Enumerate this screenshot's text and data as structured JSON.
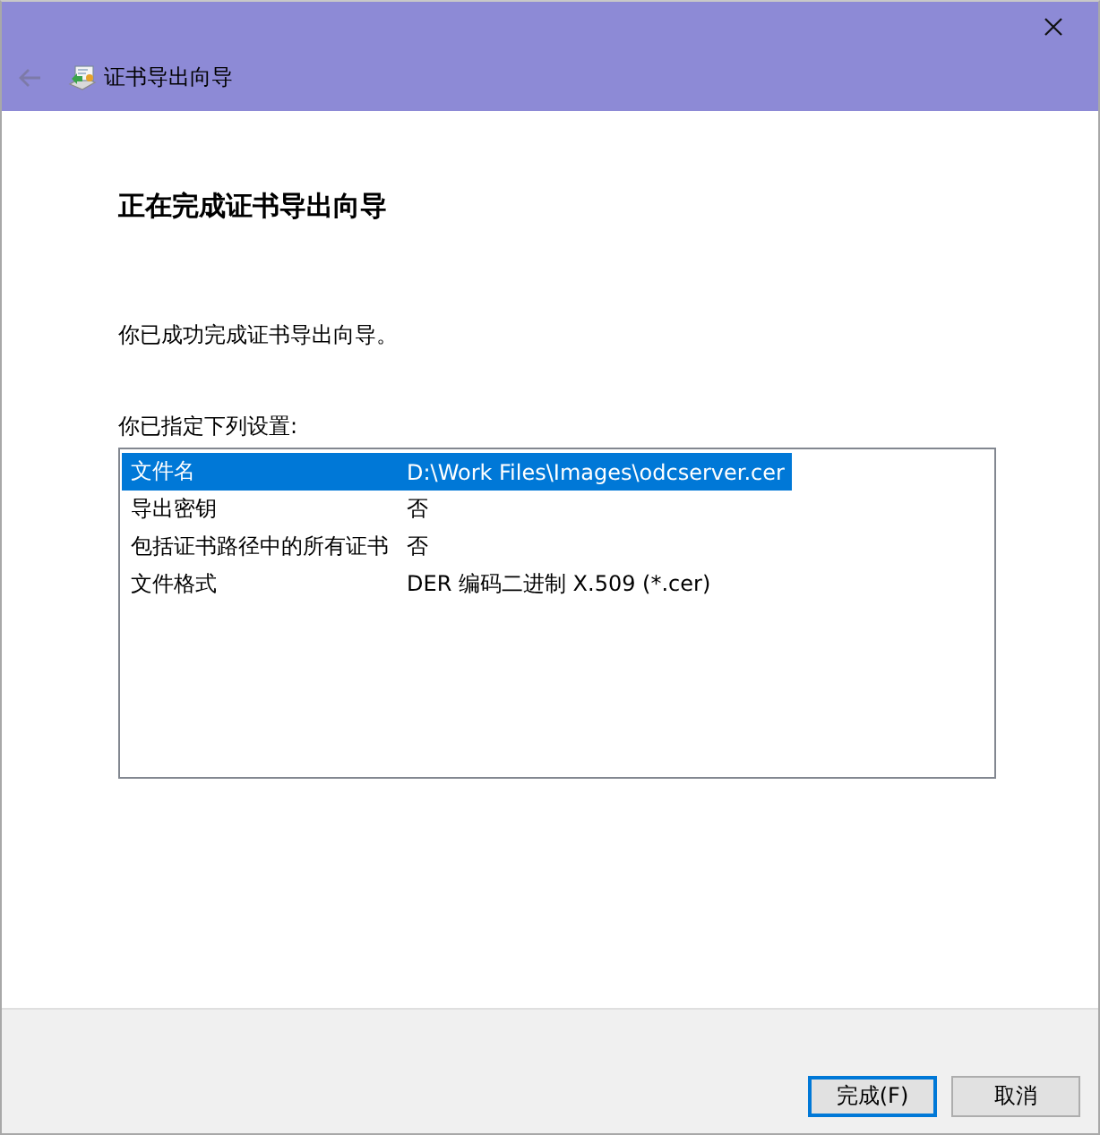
{
  "window": {
    "title": "证书导出向导",
    "back_disabled": true
  },
  "heading": "正在完成证书导出向导",
  "message": "你已成功完成证书导出向导。",
  "settings": {
    "label": "你已指定下列设置:",
    "rows": [
      {
        "name": "文件名",
        "value": "D:\\Work Files\\Images\\odcserver.cer",
        "selected": true
      },
      {
        "name": "导出密钥",
        "value": "否",
        "selected": false
      },
      {
        "name": "包括证书路径中的所有证书",
        "value": "否",
        "selected": false
      },
      {
        "name": "文件格式",
        "value": "DER 编码二进制 X.509 (*.cer)",
        "selected": false
      }
    ]
  },
  "buttons": [
    {
      "label": "完成(F)",
      "default": true
    },
    {
      "label": "取消",
      "default": false
    }
  ]
}
